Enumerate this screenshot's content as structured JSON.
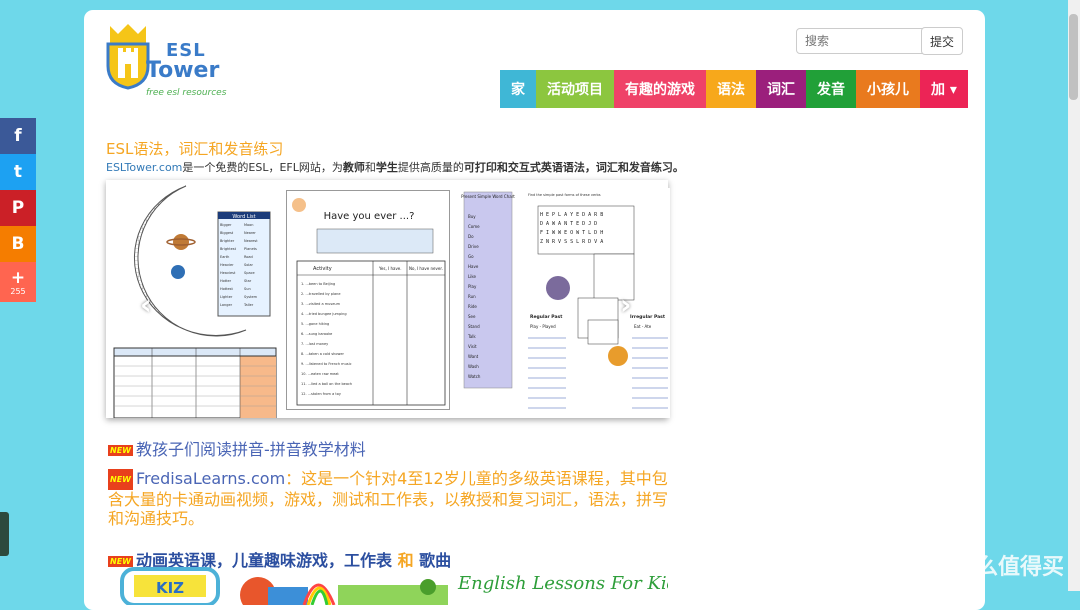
{
  "header": {
    "logo": {
      "line1": "ESL",
      "line2": "Tower",
      "tagline": "free esl resources"
    },
    "search": {
      "placeholder": "搜索",
      "button_label": "提交"
    }
  },
  "nav": {
    "items": [
      {
        "label": "家",
        "color": "#3fb7d6"
      },
      {
        "label": "活动项目",
        "color": "#8cc63f"
      },
      {
        "label": "有趣的游戏",
        "color": "#ef4268"
      },
      {
        "label": "语法",
        "color": "#f7a81b"
      },
      {
        "label": "词汇",
        "color": "#9b1f7c"
      },
      {
        "label": "发音",
        "color": "#21a038"
      },
      {
        "label": "小孩儿",
        "color": "#e97a1e"
      },
      {
        "label": "加 ▾",
        "color": "#ec2456"
      }
    ]
  },
  "main": {
    "title": "ESL语法，词汇和发音练习",
    "intro": {
      "site": "ESLTower.com",
      "part1": "是一个免费的ESL，EFL网站，为",
      "teachers": "教师",
      "and": "和",
      "students": "学生",
      "part2": "提供高质量的",
      "bold2": "可打印和交互式英语语法，词汇和发音练习。"
    },
    "slider": {
      "worksheet_title": "Have you ever ...?",
      "col_activity": "Activity",
      "col_yes": "Yes, I have.",
      "col_no": "No, I have never.",
      "word_list_title": "Word List",
      "chart_title": "Present Simple Word Chart",
      "regular_past": "Regular Past",
      "irregular_past": "Irregular Past",
      "example_regular": "Play - Played",
      "example_irregular": "Eat - Ate",
      "find_text": "Find the simple past forms of these verbs"
    },
    "news": {
      "badge": "NEW",
      "item1": "教孩子们阅读拼音-拼音教学材料",
      "item2_site": "FredisaLearns.com",
      "item2_text": "：这是一个针对4至12岁儿童的多级英语课程，其中包含大量的卡通动画视频，游戏，测试和工作表，以教授和复习词汇，语法，拼写和沟通技巧。",
      "item3_a": "动画英语课，儿童趣味游戏，工作表",
      "item3_and": "和",
      "item3_b": "歌曲"
    },
    "banner": {
      "text": "English Lessons For Kids",
      "kiz": "KIZ"
    }
  },
  "share": {
    "items": [
      {
        "icon": "facebook-icon",
        "glyph": "f",
        "color": "#3b5998"
      },
      {
        "icon": "twitter-icon",
        "glyph": "t",
        "color": "#1da1f2"
      },
      {
        "icon": "pinterest-icon",
        "glyph": "P",
        "color": "#cb2027"
      },
      {
        "icon": "blogger-icon",
        "glyph": "B",
        "color": "#f57d00"
      },
      {
        "icon": "plus-icon",
        "glyph": "+",
        "color": "#ff6550"
      }
    ],
    "count": "255"
  },
  "watermark": {
    "text": "什么值得买",
    "glyph": "值"
  }
}
